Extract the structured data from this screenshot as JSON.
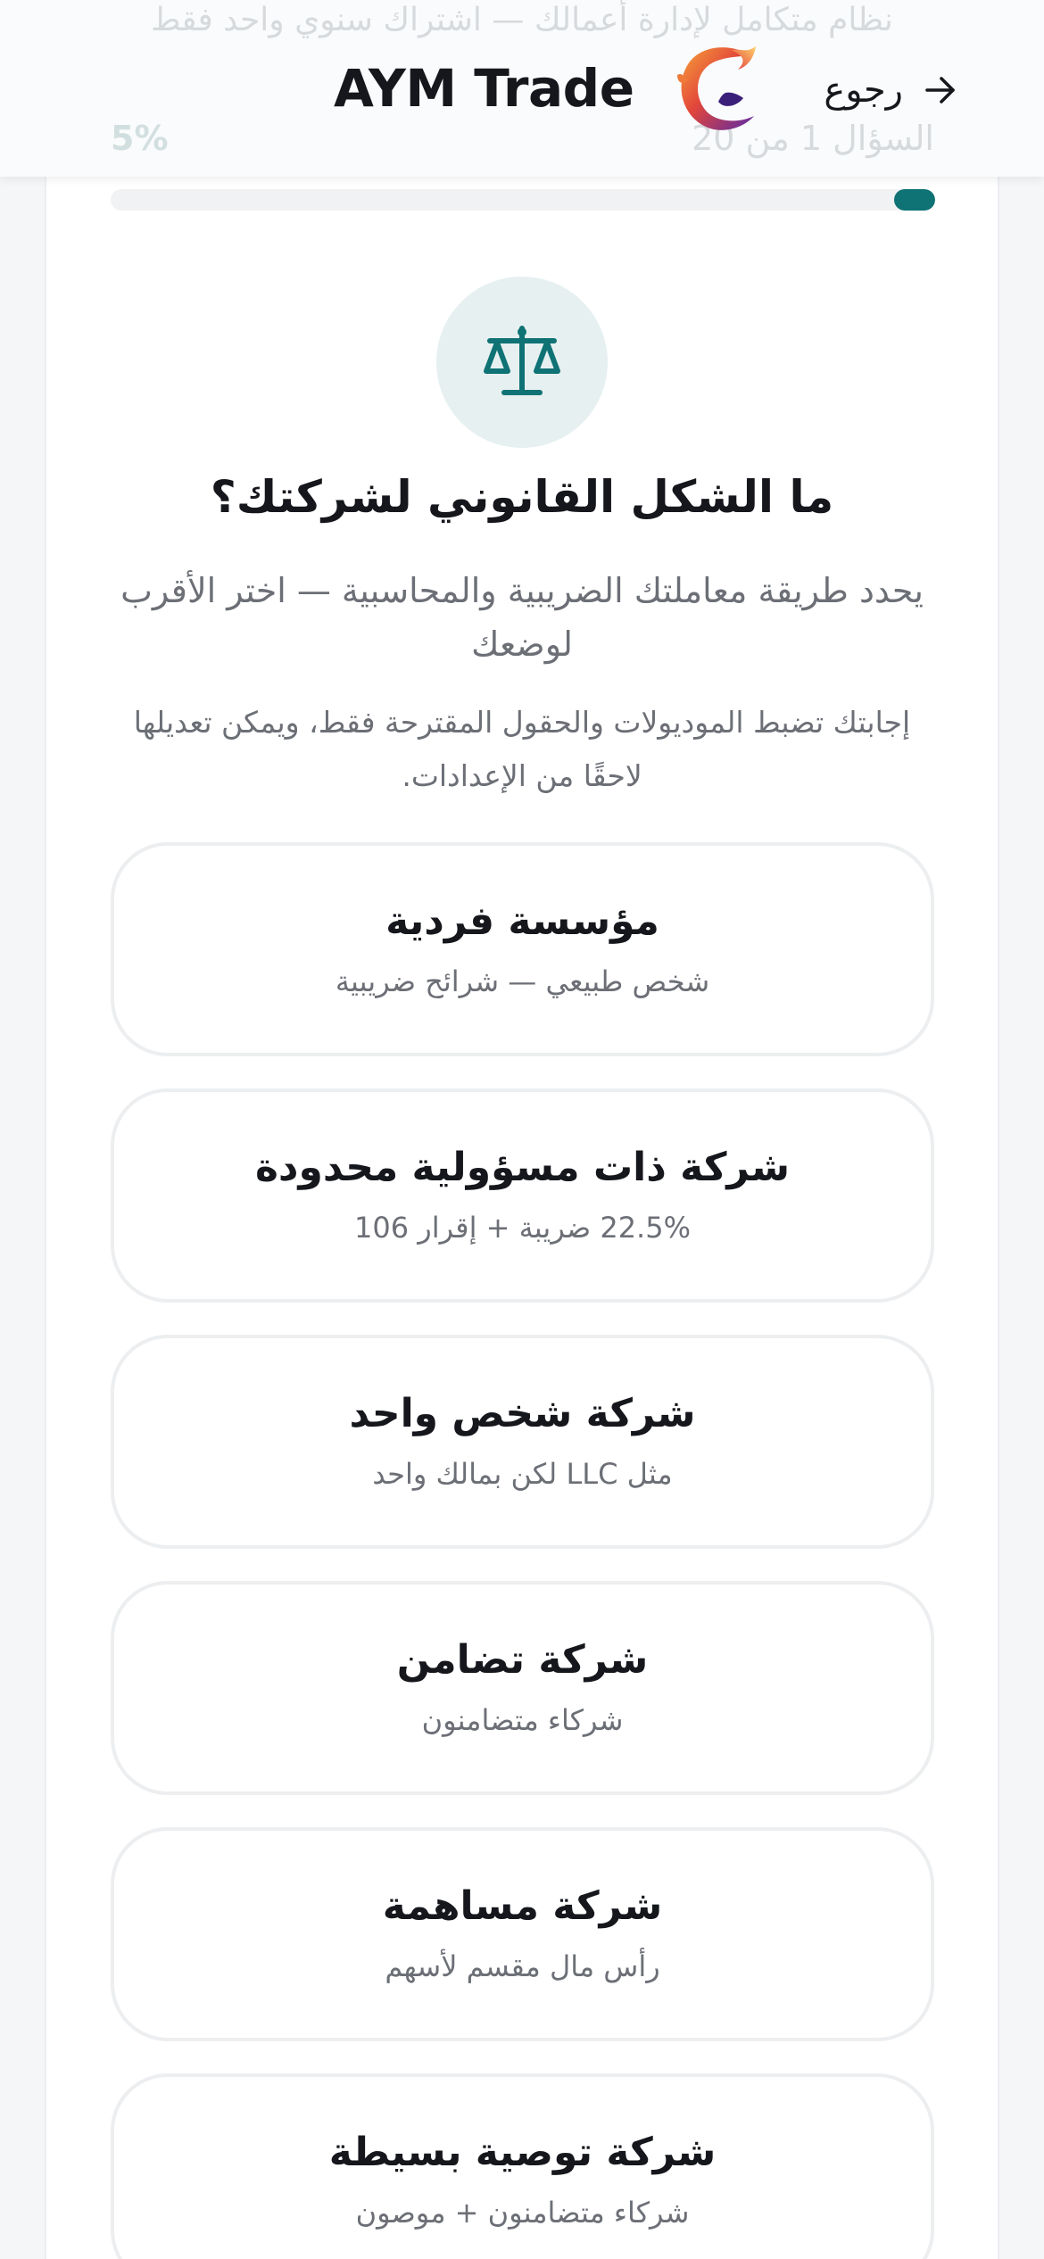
{
  "header": {
    "tagline": "نظام متكامل لإدارة أعمالك — اشتراك سنوي واحد فقط",
    "question_counter": "السؤال 1 من 20",
    "percent_label": "5%",
    "back_label": "رجوع",
    "back_icon": "arrow-right-icon",
    "brand_name": "AYM Trade",
    "brand_logo_icon": "flame-c-logo-icon"
  },
  "progress": {
    "fraction": 0.05,
    "color": "#0f7275"
  },
  "question": {
    "icon": "scale-icon",
    "title": "ما الشكل القانوني لشركتك؟",
    "subtitle": "يحدد طريقة معاملتك الضريبية والمحاسبية — اختر الأقرب لوضعك",
    "note": "إجابتك تضبط الموديولات والحقول المقترحة فقط، ويمكن تعديلها لاحقًا من الإعدادات."
  },
  "options": [
    {
      "title": "مؤسسة فردية",
      "desc": "شخص طبيعي — شرائح ضريبية"
    },
    {
      "title": "شركة ذات مسؤولية محدودة",
      "desc": "22.5% ضريبة + إقرار 106"
    },
    {
      "title": "شركة شخص واحد",
      "desc": "مثل LLC لكن بمالك واحد"
    },
    {
      "title": "شركة تضامن",
      "desc": "شركاء متضامنون"
    },
    {
      "title": "شركة مساهمة",
      "desc": "رأس مال مقسم لأسهم"
    },
    {
      "title": "شركة توصية بسيطة",
      "desc": "شركاء متضامنون + موصون"
    }
  ],
  "colors": {
    "accent": "#0f7275",
    "icon_bg": "#e6f0f0",
    "text_primary": "#15171c",
    "text_secondary": "#6c6f76",
    "border": "#eceef0"
  }
}
